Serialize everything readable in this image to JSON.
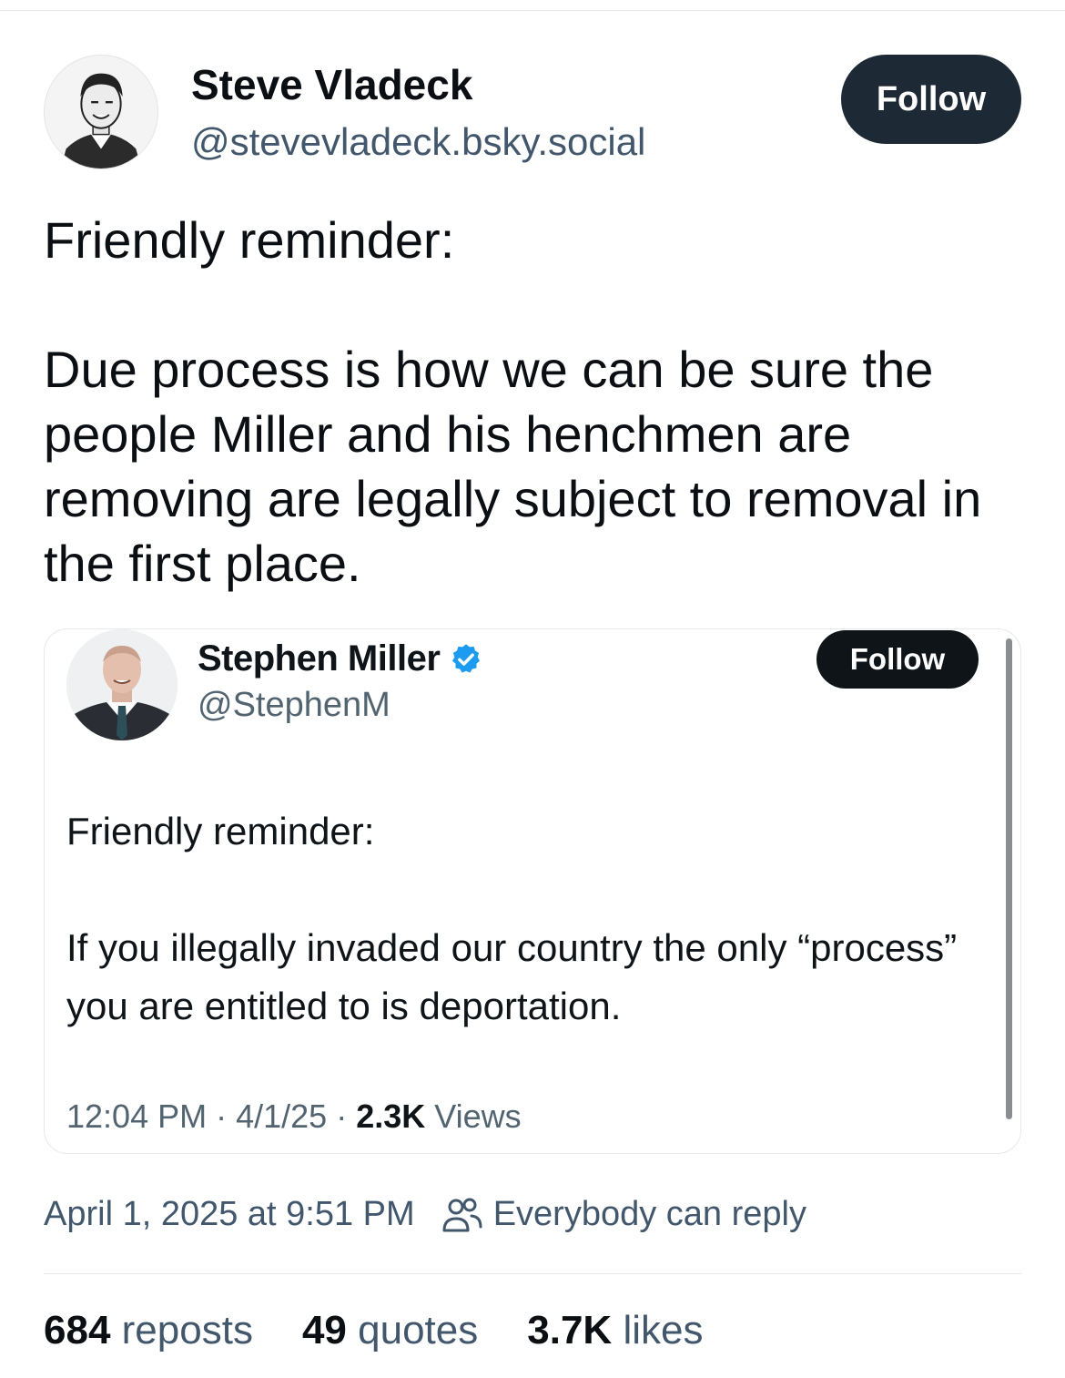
{
  "post": {
    "author_name": "Steve Vladeck",
    "author_handle": "@stevevladeck.bsky.social",
    "follow_label": "Follow",
    "paragraphs": [
      "Friendly reminder:",
      "Due process is how we can be sure the people Miller and his henchmen are removing are legally subject to removal in the first place."
    ],
    "timestamp": "April 1, 2025 at 9:51 PM",
    "reply_setting": "Everybody can reply",
    "icons": {
      "avatar": "author-avatar",
      "reply": "people-icon"
    }
  },
  "quote": {
    "author_name": "Stephen Miller",
    "author_handle": "@StephenM",
    "follow_label": "Follow",
    "paragraphs": [
      "Friendly reminder:",
      "If you illegally invaded our country the only “process” you are entitled to is deportation."
    ],
    "time": "12:04 PM",
    "date": "4/1/25",
    "sep": " · ",
    "views_count": "2.3K",
    "views_label": "Views",
    "icons": {
      "badge": "verified-badge-icon"
    }
  },
  "stats": {
    "reposts_count": "684",
    "reposts_label": "reposts",
    "quotes_count": "49",
    "quotes_label": "quotes",
    "likes_count": "3.7K",
    "likes_label": "likes"
  },
  "colors": {
    "follow_bg": "#1e2936",
    "quote_follow_bg": "#0f1419",
    "muted_text": "#42576c",
    "verified_blue": "#1d9bf0"
  }
}
